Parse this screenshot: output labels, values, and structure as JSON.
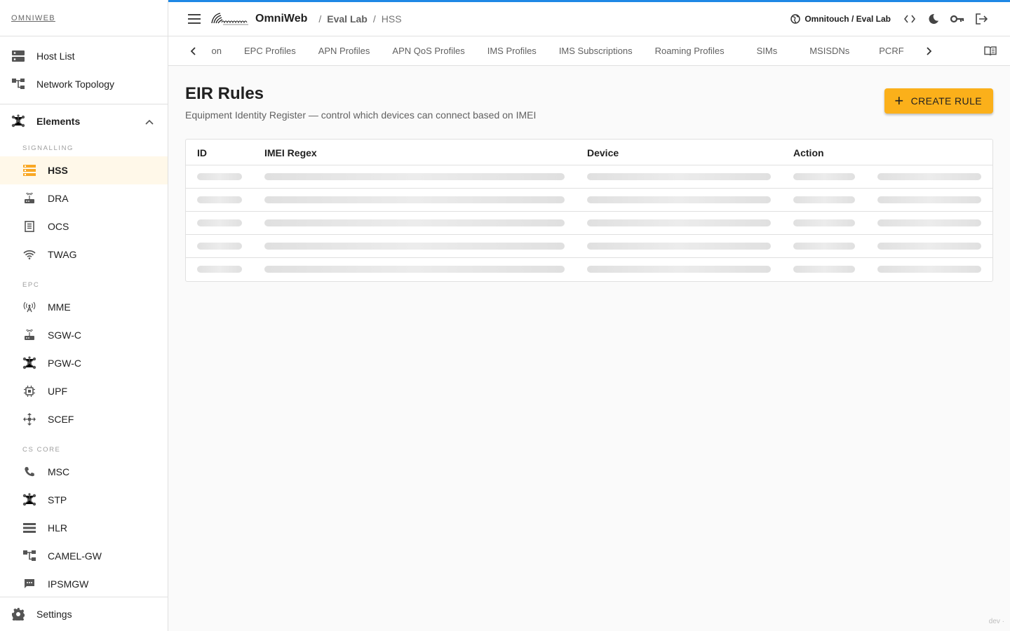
{
  "sidebar": {
    "brand": "OMNIWEB",
    "top_items": [
      {
        "label": "Host List",
        "icon": "dns-icon"
      },
      {
        "label": "Network Topology",
        "icon": "account-tree-icon"
      }
    ],
    "group": {
      "label": "Elements",
      "icon": "hub-icon",
      "expanded": true
    },
    "sections": [
      {
        "label": "SIGNALLING",
        "items": [
          {
            "label": "HSS",
            "icon": "storage-icon",
            "active": true
          },
          {
            "label": "DRA",
            "icon": "router-icon"
          },
          {
            "label": "OCS",
            "icon": "receipt-icon"
          },
          {
            "label": "TWAG",
            "icon": "wifi-icon"
          }
        ]
      },
      {
        "label": "EPC",
        "items": [
          {
            "label": "MME",
            "icon": "cell-tower-icon"
          },
          {
            "label": "SGW-C",
            "icon": "router-icon"
          },
          {
            "label": "PGW-C",
            "icon": "hub-icon"
          },
          {
            "label": "UPF",
            "icon": "chip-icon"
          },
          {
            "label": "SCEF",
            "icon": "move-icon"
          }
        ]
      },
      {
        "label": "CS CORE",
        "items": [
          {
            "label": "MSC",
            "icon": "phone-icon"
          },
          {
            "label": "STP",
            "icon": "hub-icon"
          },
          {
            "label": "HLR",
            "icon": "list-icon"
          },
          {
            "label": "CAMEL-GW",
            "icon": "account-tree-icon"
          },
          {
            "label": "IPSMGW",
            "icon": "sms-icon"
          }
        ]
      }
    ],
    "settings": "Settings"
  },
  "topbar": {
    "app_name": "OmniWeb",
    "breadcrumb": [
      "Eval Lab",
      "HSS"
    ],
    "tenant": "Omnitouch / Eval Lab",
    "accent": "#1e88e5"
  },
  "tabs": {
    "items": [
      "on",
      "EPC Profiles",
      "APN Profiles",
      "APN QoS Profiles",
      "IMS Profiles",
      "IMS Subscriptions",
      "Roaming Profiles",
      "SIMs",
      "MSISDNs",
      "PCRF"
    ]
  },
  "page": {
    "title": "EIR Rules",
    "subtitle": "Equipment Identity Register — control which devices can connect based on IMEI",
    "create_label": "CREATE RULE",
    "button_color": "#fbb01a"
  },
  "table": {
    "columns": [
      "ID",
      "IMEI Regex",
      "Device",
      "Action"
    ],
    "loading_rows": 5
  },
  "footer_tag": "dev ·"
}
